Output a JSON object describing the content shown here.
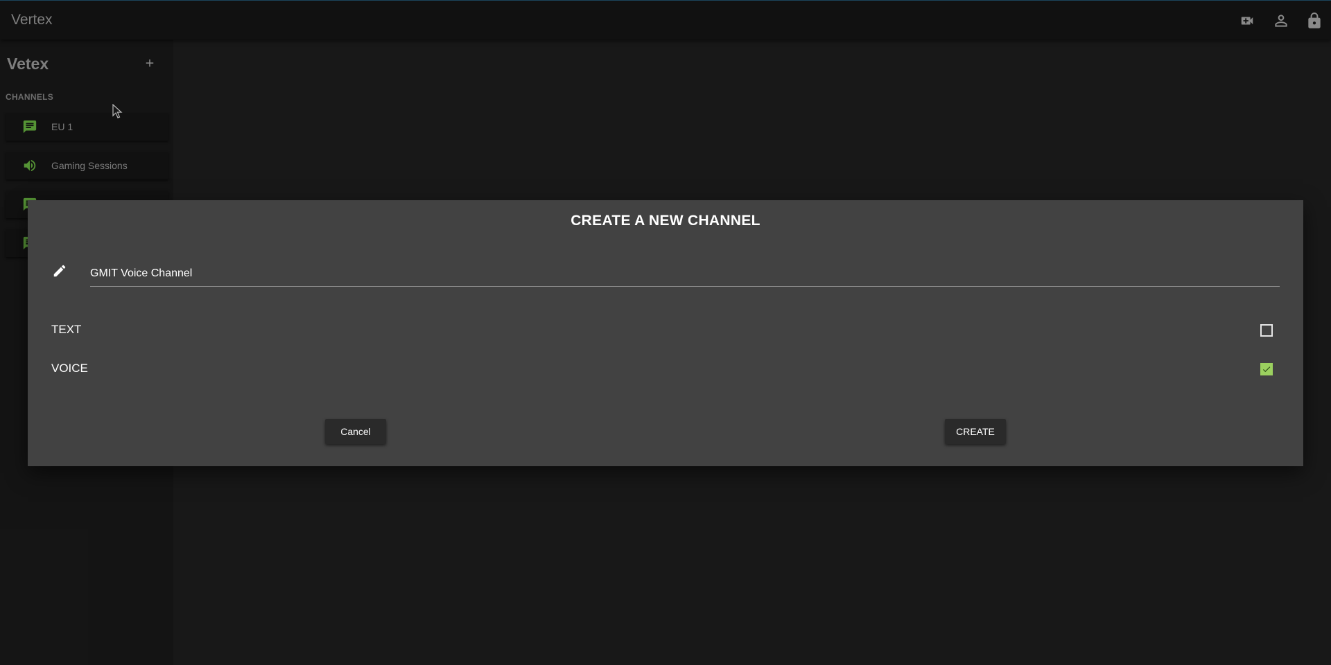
{
  "app": {
    "title": "Vertex"
  },
  "topbar": {
    "icons": [
      "video-add-icon",
      "account-icon",
      "lock-icon"
    ]
  },
  "sidebar": {
    "server_name": "Vetex",
    "section_label": "CHANNELS",
    "channels": [
      {
        "label": "EU 1",
        "type": "text",
        "icon": "chat-icon"
      },
      {
        "label": "Gaming Sessions",
        "type": "voice",
        "icon": "speaker-icon"
      },
      {
        "label": "",
        "type": "text",
        "icon": "chat-icon"
      },
      {
        "label": "",
        "type": "text",
        "icon": "chat-icon"
      }
    ]
  },
  "dialog": {
    "title": "CREATE A NEW CHANNEL",
    "name_value": "GMIT Voice Channel",
    "options": [
      {
        "label": "TEXT",
        "checked": false
      },
      {
        "label": "VOICE",
        "checked": true
      }
    ],
    "cancel_label": "Cancel",
    "create_label": "CREATE"
  },
  "colors": {
    "accent_green": "#9bd05f",
    "channel_icon_green": "#5fa53b",
    "dialog_bg": "#424242",
    "app_bg": "#1b1b1b"
  }
}
